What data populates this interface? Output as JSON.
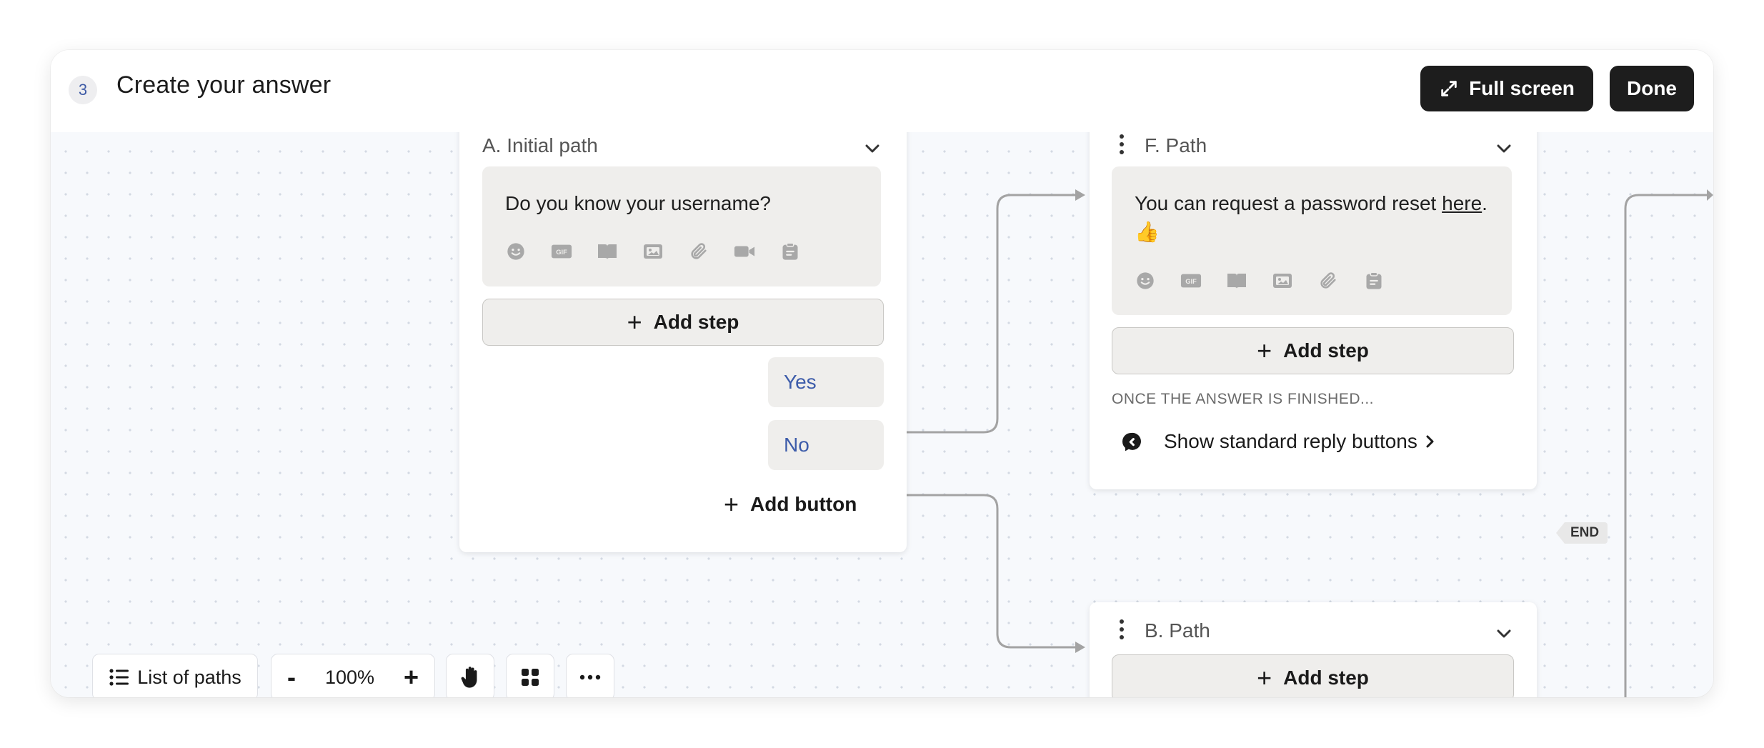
{
  "header": {
    "step_number": "3",
    "title": "Create your answer",
    "fullscreen_label": "Full screen",
    "done_label": "Done"
  },
  "node_a": {
    "title": "A. Initial path",
    "message": "Do you know your username?",
    "add_step_label": "Add step",
    "buttons": [
      {
        "label": "Yes"
      },
      {
        "label": "No"
      }
    ],
    "add_button_label": "Add button"
  },
  "node_f": {
    "title": "F. Path",
    "message_before": "You can request a password reset ",
    "message_link": "here",
    "message_after": ". 👍",
    "add_step_label": "Add step",
    "once_finished_label": "ONCE THE ANSWER IS FINISHED...",
    "standard_reply_label": "Show standard reply buttons"
  },
  "end_tag": "END",
  "node_b": {
    "title": "B. Path",
    "add_step_label": "Add step"
  },
  "toolbar": {
    "list_paths_label": "List of paths",
    "zoom_minus": "-",
    "zoom_value": "100%",
    "zoom_plus": "+"
  },
  "colors": {
    "accent_link": "#3d5caa",
    "dark_button": "#1d1d1d",
    "message_bg": "#efeeec"
  }
}
